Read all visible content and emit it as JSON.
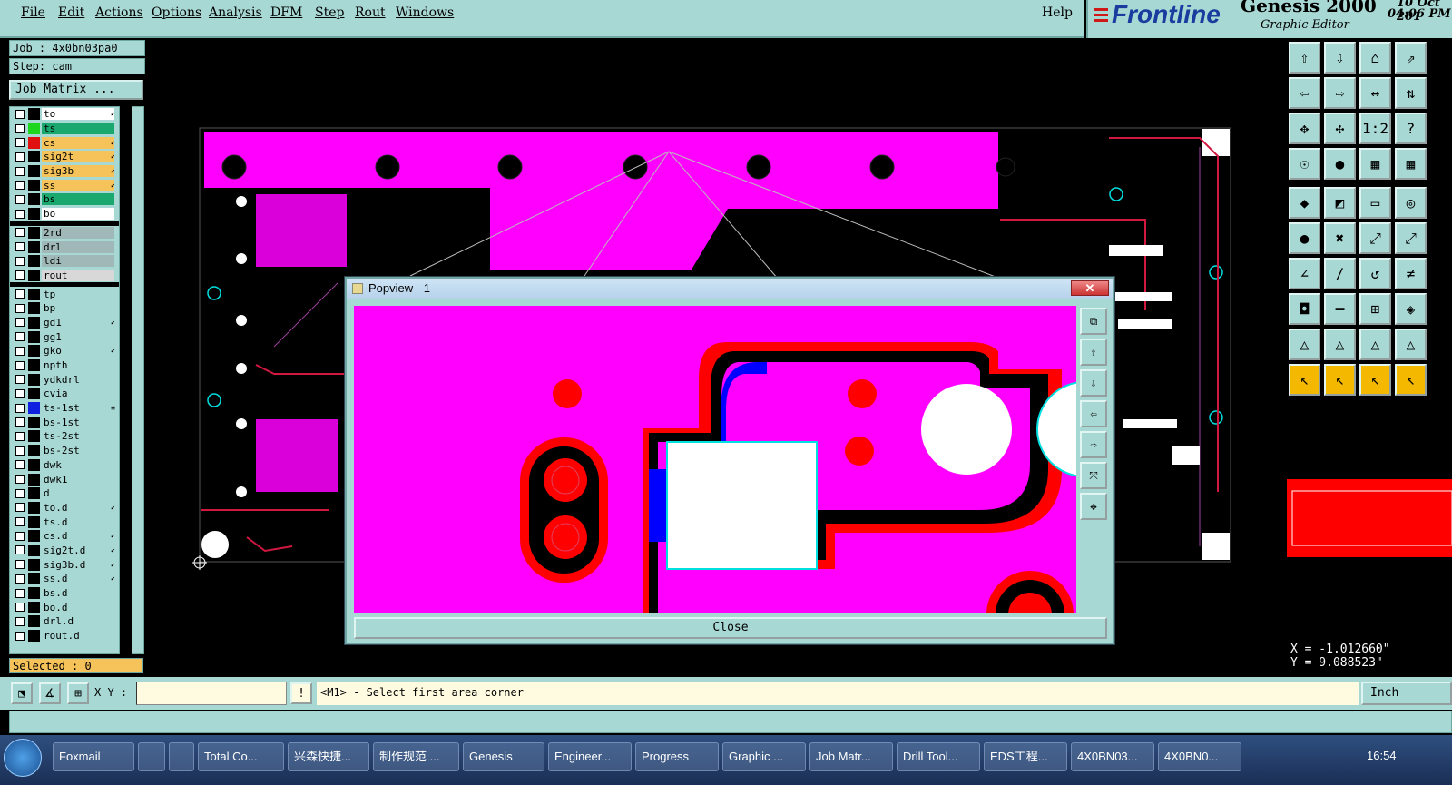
{
  "menu": {
    "items": [
      "File",
      "Edit",
      "Actions",
      "Options",
      "Analysis",
      "DFM",
      "Step",
      "Rout",
      "Windows"
    ],
    "help": "Help"
  },
  "brand": {
    "logo": "Frontline",
    "title": "Genesis 2000",
    "subtitle": "Graphic Editor",
    "date": "10 Oct 201",
    "time": "04:06 PM"
  },
  "job": {
    "job_label": "Job : 4x0bn03pa0",
    "step_label": "Step: cam",
    "matrix_button": "Job Matrix ..."
  },
  "layers": [
    {
      "name": "to",
      "color": "#ffffff",
      "tick": "⬋",
      "dot": "#000"
    },
    {
      "name": "ts",
      "color": "#1aa86e",
      "tick": "",
      "dot": "#1dd61d"
    },
    {
      "name": "cs",
      "color": "#f5c35a",
      "tick": "⬋",
      "dot": "#e01010"
    },
    {
      "name": "sig2t",
      "color": "#f5c35a",
      "tick": "⬋",
      "dot": "#000"
    },
    {
      "name": "sig3b",
      "color": "#f5c35a",
      "tick": "⬋",
      "dot": "#000"
    },
    {
      "name": "ss",
      "color": "#f5c35a",
      "tick": "⬋",
      "dot": "#000"
    },
    {
      "name": "bs",
      "color": "#1aa86e",
      "tick": "",
      "dot": "#000"
    },
    {
      "name": "bo",
      "color": "#ffffff",
      "tick": "",
      "dot": "#000"
    },
    {
      "name": "",
      "color": "#000000",
      "tick": "",
      "dot": "#000"
    },
    {
      "name": "2rd",
      "color": "#a0b8b8",
      "tick": "",
      "dot": "#000"
    },
    {
      "name": "drl",
      "color": "#a0b8b8",
      "tick": "",
      "dot": "#000"
    },
    {
      "name": "ldi",
      "color": "#a0b8b8",
      "tick": "",
      "dot": "#000"
    },
    {
      "name": "rout",
      "color": "#d8d8d8",
      "tick": "",
      "dot": "#000"
    },
    {
      "name": "",
      "color": "#000000",
      "tick": "",
      "dot": "#000"
    },
    {
      "name": "tp",
      "color": "#a8d8d4",
      "tick": "",
      "dot": "#000"
    },
    {
      "name": "bp",
      "color": "#a8d8d4",
      "tick": "",
      "dot": "#000"
    },
    {
      "name": "gd1",
      "color": "#a8d8d4",
      "tick": "⬋",
      "dot": "#000"
    },
    {
      "name": "gg1",
      "color": "#a8d8d4",
      "tick": "",
      "dot": "#000"
    },
    {
      "name": "gko",
      "color": "#a8d8d4",
      "tick": "⬋",
      "dot": "#000"
    },
    {
      "name": "npth",
      "color": "#a8d8d4",
      "tick": "",
      "dot": "#000"
    },
    {
      "name": "ydkdrl",
      "color": "#a8d8d4",
      "tick": "",
      "dot": "#000"
    },
    {
      "name": "cvia",
      "color": "#a8d8d4",
      "tick": "",
      "dot": "#000"
    },
    {
      "name": "ts-1st",
      "color": "#a8d8d4",
      "tick": "≡",
      "dot": "#1020e0"
    },
    {
      "name": "bs-1st",
      "color": "#a8d8d4",
      "tick": "",
      "dot": "#000"
    },
    {
      "name": "ts-2st",
      "color": "#a8d8d4",
      "tick": "",
      "dot": "#000"
    },
    {
      "name": "bs-2st",
      "color": "#a8d8d4",
      "tick": "",
      "dot": "#000"
    },
    {
      "name": "dwk",
      "color": "#a8d8d4",
      "tick": "",
      "dot": "#000"
    },
    {
      "name": "dwk1",
      "color": "#a8d8d4",
      "tick": "",
      "dot": "#000"
    },
    {
      "name": "d",
      "color": "#a8d8d4",
      "tick": "",
      "dot": "#000"
    },
    {
      "name": "to.d",
      "color": "#a8d8d4",
      "tick": "⬋",
      "dot": "#000"
    },
    {
      "name": "ts.d",
      "color": "#a8d8d4",
      "tick": "",
      "dot": "#000"
    },
    {
      "name": "cs.d",
      "color": "#a8d8d4",
      "tick": "⬋",
      "dot": "#000"
    },
    {
      "name": "sig2t.d",
      "color": "#a8d8d4",
      "tick": "⬋",
      "dot": "#000"
    },
    {
      "name": "sig3b.d",
      "color": "#a8d8d4",
      "tick": "⬋",
      "dot": "#000"
    },
    {
      "name": "ss.d",
      "color": "#a8d8d4",
      "tick": "⬋",
      "dot": "#000"
    },
    {
      "name": "bs.d",
      "color": "#a8d8d4",
      "tick": "",
      "dot": "#000"
    },
    {
      "name": "bo.d",
      "color": "#a8d8d4",
      "tick": "",
      "dot": "#000"
    },
    {
      "name": "drl.d",
      "color": "#a8d8d4",
      "tick": "",
      "dot": "#000"
    },
    {
      "name": "rout.d",
      "color": "#a8d8d4",
      "tick": "",
      "dot": "#000"
    }
  ],
  "selected": "Selected : 0",
  "coords": {
    "x": "X = -1.012660\"",
    "y": "Y = 9.088523\""
  },
  "status": {
    "xy_label": "X Y :",
    "xy_value": "",
    "prompt": "<M1> - Select first area corner",
    "units": "Inch"
  },
  "popup": {
    "title": "Popview - 1",
    "close_x": "✕",
    "close_label": "Close"
  },
  "tools": [
    [
      "⇧",
      "⇩",
      "⌂",
      "⇗"
    ],
    [
      "⇦",
      "⇨",
      "↔",
      "⇅"
    ],
    [
      "✥",
      "✣",
      "1:2",
      "?"
    ],
    [
      "☉",
      "●",
      "▦",
      "▦"
    ],
    [
      "◆",
      "◩",
      "▭",
      "◎"
    ],
    [
      "●",
      "✖",
      "⤢",
      "⤢"
    ],
    [
      "∠",
      "∕",
      "↺",
      "≠"
    ],
    [
      "◘",
      "━",
      "⊞",
      "◈"
    ],
    [
      "△",
      "△",
      "△",
      "△"
    ],
    [
      "↖",
      "↖",
      "↖",
      "↖"
    ]
  ],
  "taskbar": [
    {
      "label": "Foxmail"
    },
    {
      "label": ""
    },
    {
      "label": ""
    },
    {
      "label": "Total Co..."
    },
    {
      "label": "兴森快捷..."
    },
    {
      "label": "制作规范 ..."
    },
    {
      "label": "Genesis"
    },
    {
      "label": "Engineer..."
    },
    {
      "label": "Progress"
    },
    {
      "label": "Graphic ..."
    },
    {
      "label": "Job Matr..."
    },
    {
      "label": "Drill Tool..."
    },
    {
      "label": "EDS工程..."
    },
    {
      "label": "4X0BN03..."
    },
    {
      "label": "4X0BN0..."
    }
  ],
  "clock": "16:54",
  "colors": {
    "panel": "#a8d8d4",
    "magenta": "#ff00ff",
    "red": "#ff0000",
    "blue": "#0000ff",
    "white": "#ffffff"
  }
}
